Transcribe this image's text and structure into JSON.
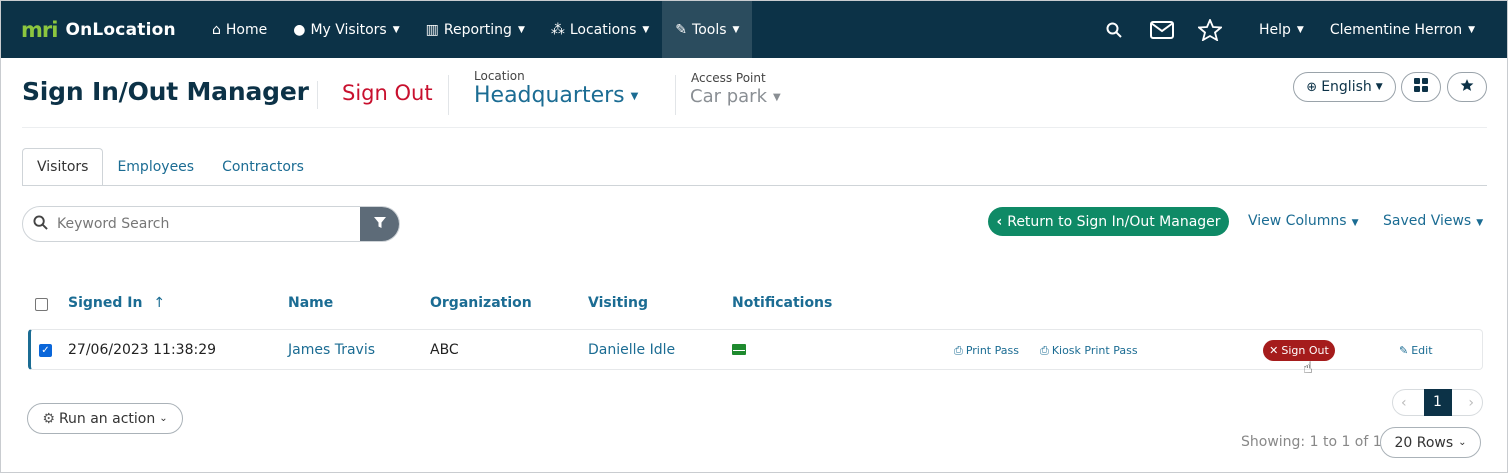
{
  "nav": {
    "brand_mark": "mri",
    "brand_name": "OnLocation",
    "items": [
      {
        "label": "Home",
        "icon": "home-icon"
      },
      {
        "label": "My Visitors",
        "icon": "user-icon"
      },
      {
        "label": "Reporting",
        "icon": "bar-chart-icon"
      },
      {
        "label": "Locations",
        "icon": "network-icon"
      },
      {
        "label": "Tools",
        "icon": "wrench-icon"
      }
    ],
    "help_label": "Help",
    "user_name": "Clementine Herron"
  },
  "header": {
    "title": "Sign In/Out Manager",
    "mode": "Sign Out",
    "location_label": "Location",
    "location_value": "Headquarters",
    "access_point_label": "Access Point",
    "access_point_value": "Car park",
    "language": "English"
  },
  "tabs": [
    "Visitors",
    "Employees",
    "Contractors"
  ],
  "search": {
    "placeholder": "Keyword Search"
  },
  "toolbar": {
    "return_label": "Return to Sign In/Out Manager",
    "view_columns": "View Columns",
    "saved_views": "Saved Views"
  },
  "table": {
    "columns": [
      "Signed In",
      "Name",
      "Organization",
      "Visiting",
      "Notifications"
    ],
    "sort_indicator": "↑",
    "rows": [
      {
        "signed_in": "27/06/2023 11:38:29",
        "name": "James Travis",
        "organization": "ABC",
        "visiting": "Danielle Idle",
        "print_pass": "Print Pass",
        "kiosk_print_pass": "Kiosk Print Pass",
        "sign_out": "Sign Out",
        "edit": "Edit",
        "selected": true
      }
    ]
  },
  "footer": {
    "run_action": "Run an action",
    "page": "1",
    "showing": "Showing: 1 to 1 of 1",
    "rows_per_page": "20 Rows"
  },
  "colors": {
    "nav_bg": "#0c3247",
    "accent_link": "#1b6c93",
    "sign_out_red": "#a51c1c",
    "return_green": "#0f8a66",
    "mode_red": "#c8102e"
  }
}
